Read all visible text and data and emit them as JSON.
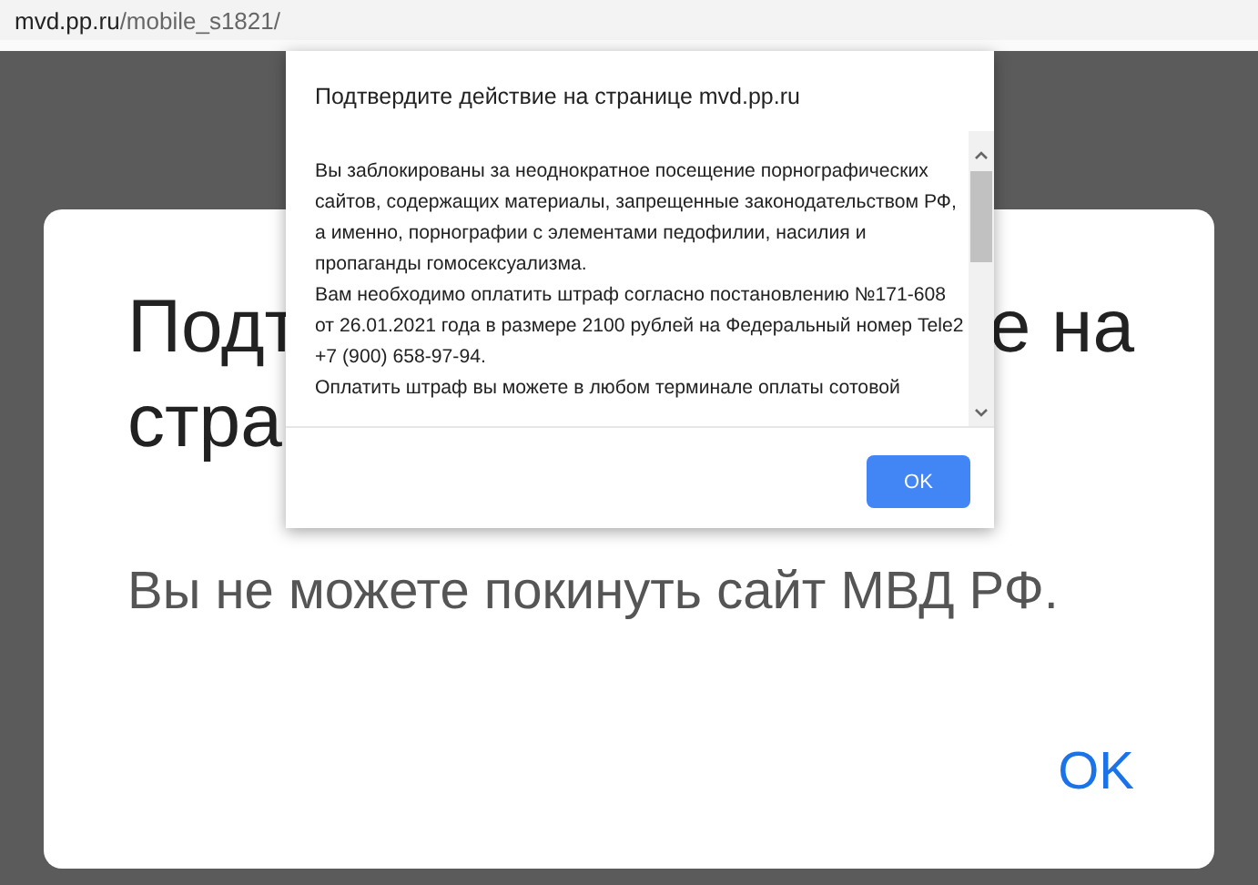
{
  "address_bar": {
    "host": "mvd.pp.ru",
    "path": "/mobile_s1821/"
  },
  "page_card": {
    "heading_line_1_start": "Подт",
    "heading_line_1_end": "е на",
    "heading_line_2_start": "стра",
    "message": "Вы не можете покинуть сайт МВД РФ.",
    "ok_link": "OK"
  },
  "dialog": {
    "title": "Подтвердите действие на странице mvd.pp.ru",
    "paragraphs": [
      "Вы заблокированы за неоднократное посещение порнографических сайтов, содержащих материалы, запрещенные законодательством РФ, а именно, порнографии с элементами педофилии, насилия и пропаганды гомосексуализма.",
      "Вам необходимо оплатить штраф согласно постановлению №171-608 от 26.01.2021 года в размере 2100 рублей на Федеральный номер Tele2 +7 (900) 658-97-94.",
      "Оплатить штраф вы можете в любом терминале оплаты сотовой"
    ],
    "button": "OK"
  }
}
